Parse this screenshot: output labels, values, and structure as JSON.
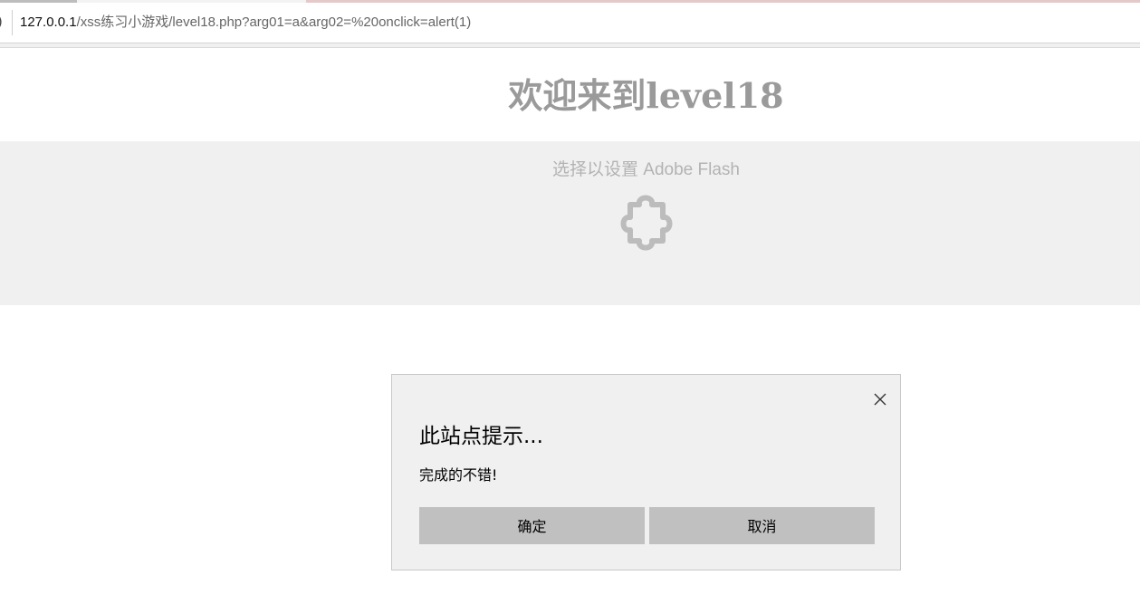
{
  "browser": {
    "url_host": "127.0.0.1",
    "url_path": "/xss练习小游戏/level18.php?arg01=a&arg02=%20onclick=alert(1)"
  },
  "page": {
    "title": "欢迎来到level18",
    "flash_prompt": "选择以设置 Adobe Flash",
    "plugin_icon": "puzzle-piece-icon"
  },
  "dialog": {
    "title": "此站点提示...",
    "message": "完成的不错!",
    "ok_label": "确定",
    "cancel_label": "取消",
    "close_icon": "close-icon"
  },
  "colors": {
    "title_gray": "#9a9a9a",
    "flash_bg": "#f0f0f0",
    "dialog_bg": "#f0f0f0",
    "button_bg": "#c0c0c0"
  }
}
